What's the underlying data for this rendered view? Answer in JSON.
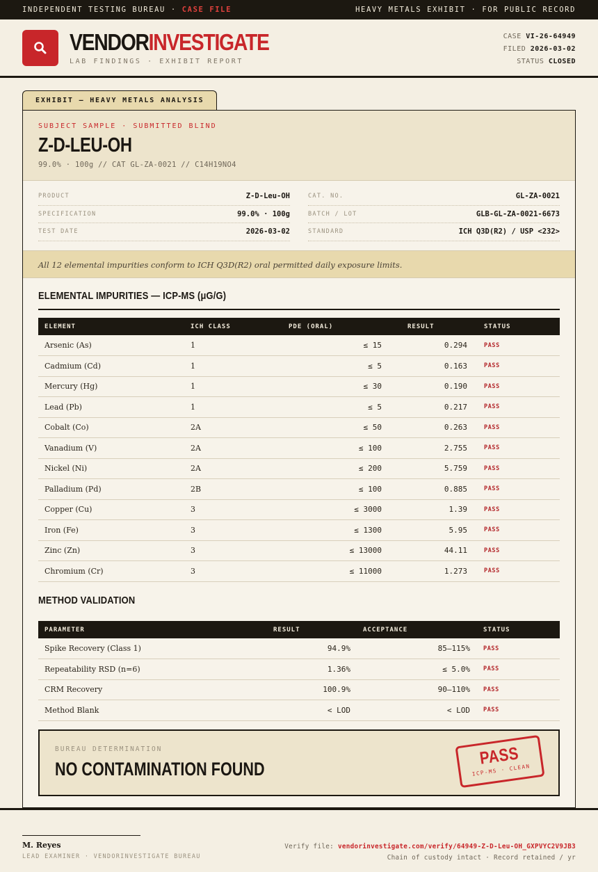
{
  "topbar": {
    "left_prefix": "INDEPENDENT TESTING BUREAU ·",
    "left_highlight": "CASE FILE",
    "right": "HEAVY METALS EXHIBIT · FOR PUBLIC RECORD"
  },
  "brand": {
    "name_part1": "VENDOR",
    "name_part2": "INVESTIGATE",
    "subtitle": "LAB FINDINGS · EXHIBIT REPORT",
    "icon": "magnifier-icon",
    "accent_color": "#c8262a"
  },
  "case": {
    "case_label": "CASE",
    "case_value": "VI-26-64949",
    "filed_label": "FILED",
    "filed_value": "2026-03-02",
    "status_label": "STATUS",
    "status_value": "CLOSED"
  },
  "exhibit_tab": "EXHIBIT — HEAVY METALS ANALYSIS",
  "subject": {
    "kicker": "SUBJECT SAMPLE · SUBMITTED BLIND",
    "title": "Z-D-LEU-OH",
    "meta": "99.0% · 100g  //  CAT GL-ZA-0021  //  C14H19NO4"
  },
  "details": {
    "left": [
      {
        "label": "PRODUCT",
        "value": "Z-D-Leu-OH"
      },
      {
        "label": "SPECIFICATION",
        "value": "99.0% · 100g"
      },
      {
        "label": "TEST DATE",
        "value": "2026-03-02"
      }
    ],
    "right": [
      {
        "label": "CAT. NO.",
        "value": "GL-ZA-0021"
      },
      {
        "label": "BATCH / LOT",
        "value": "GLB-GL-ZA-0021-6673"
      },
      {
        "label": "STANDARD",
        "value": "ICH Q3D(R2) / USP <232>"
      }
    ]
  },
  "conformance_note": "All 12 elemental impurities conform to ICH Q3D(R2) oral permitted daily exposure limits.",
  "impurities": {
    "title": "ELEMENTAL IMPURITIES — ICP-MS (μG/G)",
    "headers": [
      "ELEMENT",
      "ICH CLASS",
      "PDE (ORAL)",
      "RESULT",
      "STATUS"
    ],
    "rows": [
      {
        "element": "Arsenic (As)",
        "class": "1",
        "pde": "≤ 15",
        "result": "0.294",
        "status": "PASS"
      },
      {
        "element": "Cadmium (Cd)",
        "class": "1",
        "pde": "≤ 5",
        "result": "0.163",
        "status": "PASS"
      },
      {
        "element": "Mercury (Hg)",
        "class": "1",
        "pde": "≤ 30",
        "result": "0.190",
        "status": "PASS"
      },
      {
        "element": "Lead (Pb)",
        "class": "1",
        "pde": "≤ 5",
        "result": "0.217",
        "status": "PASS"
      },
      {
        "element": "Cobalt (Co)",
        "class": "2A",
        "pde": "≤ 50",
        "result": "0.263",
        "status": "PASS"
      },
      {
        "element": "Vanadium (V)",
        "class": "2A",
        "pde": "≤ 100",
        "result": "2.755",
        "status": "PASS"
      },
      {
        "element": "Nickel (Ni)",
        "class": "2A",
        "pde": "≤ 200",
        "result": "5.759",
        "status": "PASS"
      },
      {
        "element": "Palladium (Pd)",
        "class": "2B",
        "pde": "≤ 100",
        "result": "0.885",
        "status": "PASS"
      },
      {
        "element": "Copper (Cu)",
        "class": "3",
        "pde": "≤ 3000",
        "result": "1.39",
        "status": "PASS"
      },
      {
        "element": "Iron (Fe)",
        "class": "3",
        "pde": "≤ 1300",
        "result": "5.95",
        "status": "PASS"
      },
      {
        "element": "Zinc (Zn)",
        "class": "3",
        "pde": "≤ 13000",
        "result": "44.11",
        "status": "PASS"
      },
      {
        "element": "Chromium (Cr)",
        "class": "3",
        "pde": "≤ 11000",
        "result": "1.273",
        "status": "PASS"
      }
    ]
  },
  "validation": {
    "title": "METHOD VALIDATION",
    "headers": [
      "PARAMETER",
      "RESULT",
      "ACCEPTANCE",
      "STATUS"
    ],
    "rows": [
      {
        "parameter": "Spike Recovery (Class 1)",
        "result": "94.9%",
        "acceptance": "85–115%",
        "status": "PASS"
      },
      {
        "parameter": "Repeatability RSD (n=6)",
        "result": "1.36%",
        "acceptance": "≤ 5.0%",
        "status": "PASS"
      },
      {
        "parameter": "CRM Recovery",
        "result": "100.9%",
        "acceptance": "90–110%",
        "status": "PASS"
      },
      {
        "parameter": "Method Blank",
        "result": "< LOD",
        "acceptance": "< LOD",
        "status": "PASS"
      }
    ]
  },
  "determination": {
    "kicker": "BUREAU DETERMINATION",
    "text": "NO CONTAMINATION FOUND",
    "stamp_main": "PASS",
    "stamp_sub": "ICP-MS · CLEAN"
  },
  "footer": {
    "examiner_name": "M. Reyes",
    "examiner_role": "LEAD EXAMINER · VENDORINVESTIGATE BUREAU",
    "verify_label": "Verify file:",
    "verify_link": "vendorinvestigate.com/verify/64949-Z-D-Leu-OH_GXPVYC2V9JB3",
    "custody_note": "Chain of custody intact · Record retained / yr"
  }
}
